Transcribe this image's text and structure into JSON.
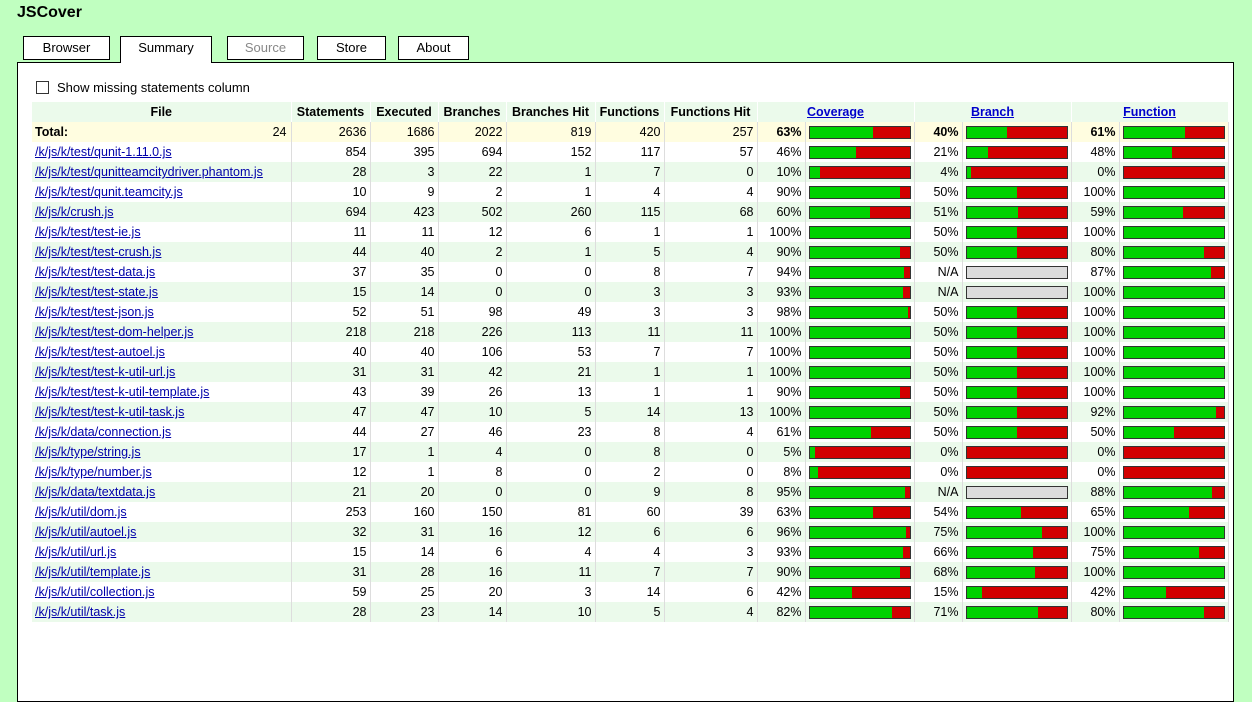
{
  "app": {
    "title": "JSCover"
  },
  "tabs": [
    {
      "label": "Browser",
      "state": "normal"
    },
    {
      "label": "Summary",
      "state": "active"
    },
    {
      "label": "Source",
      "state": "disabled"
    },
    {
      "label": "Store",
      "state": "normal"
    },
    {
      "label": "About",
      "state": "normal"
    }
  ],
  "options": {
    "show_missing_label": "Show missing statements column",
    "show_missing_checked": false
  },
  "colors": {
    "covered": "#00d200",
    "missed": "#d20000",
    "na": "#dcdcdc",
    "background": "#c0ffc0"
  },
  "table": {
    "headers": {
      "file": "File",
      "statements": "Statements",
      "executed": "Executed",
      "branches": "Branches",
      "branches_hit": "Branches Hit",
      "functions": "Functions",
      "functions_hit": "Functions Hit",
      "coverage": "Coverage",
      "branch": "Branch",
      "function": "Function"
    },
    "total": {
      "label": "Total:",
      "files": "24",
      "statements": "2636",
      "executed": "1686",
      "branches": "2022",
      "branches_hit": "819",
      "functions": "420",
      "functions_hit": "257",
      "coverage": "63%",
      "branch": "40%",
      "function": "61%"
    },
    "rows": [
      {
        "file": "/k/js/k/test/qunit-1.11.0.js",
        "statements": "854",
        "executed": "395",
        "branches": "694",
        "branches_hit": "152",
        "functions": "117",
        "functions_hit": "57",
        "coverage": "46%",
        "branch": "21%",
        "function": "48%"
      },
      {
        "file": "/k/js/k/test/qunitteamcitydriver.phantom.js",
        "statements": "28",
        "executed": "3",
        "branches": "22",
        "branches_hit": "1",
        "functions": "7",
        "functions_hit": "0",
        "coverage": "10%",
        "branch": "4%",
        "function": "0%"
      },
      {
        "file": "/k/js/k/test/qunit.teamcity.js",
        "statements": "10",
        "executed": "9",
        "branches": "2",
        "branches_hit": "1",
        "functions": "4",
        "functions_hit": "4",
        "coverage": "90%",
        "branch": "50%",
        "function": "100%"
      },
      {
        "file": "/k/js/k/crush.js",
        "statements": "694",
        "executed": "423",
        "branches": "502",
        "branches_hit": "260",
        "functions": "115",
        "functions_hit": "68",
        "coverage": "60%",
        "branch": "51%",
        "function": "59%"
      },
      {
        "file": "/k/js/k/test/test-ie.js",
        "statements": "11",
        "executed": "11",
        "branches": "12",
        "branches_hit": "6",
        "functions": "1",
        "functions_hit": "1",
        "coverage": "100%",
        "branch": "50%",
        "function": "100%"
      },
      {
        "file": "/k/js/k/test/test-crush.js",
        "statements": "44",
        "executed": "40",
        "branches": "2",
        "branches_hit": "1",
        "functions": "5",
        "functions_hit": "4",
        "coverage": "90%",
        "branch": "50%",
        "function": "80%"
      },
      {
        "file": "/k/js/k/test/test-data.js",
        "statements": "37",
        "executed": "35",
        "branches": "0",
        "branches_hit": "0",
        "functions": "8",
        "functions_hit": "7",
        "coverage": "94%",
        "branch": "N/A",
        "function": "87%"
      },
      {
        "file": "/k/js/k/test/test-state.js",
        "statements": "15",
        "executed": "14",
        "branches": "0",
        "branches_hit": "0",
        "functions": "3",
        "functions_hit": "3",
        "coverage": "93%",
        "branch": "N/A",
        "function": "100%"
      },
      {
        "file": "/k/js/k/test/test-json.js",
        "statements": "52",
        "executed": "51",
        "branches": "98",
        "branches_hit": "49",
        "functions": "3",
        "functions_hit": "3",
        "coverage": "98%",
        "branch": "50%",
        "function": "100%"
      },
      {
        "file": "/k/js/k/test/test-dom-helper.js",
        "statements": "218",
        "executed": "218",
        "branches": "226",
        "branches_hit": "113",
        "functions": "11",
        "functions_hit": "11",
        "coverage": "100%",
        "branch": "50%",
        "function": "100%"
      },
      {
        "file": "/k/js/k/test/test-autoel.js",
        "statements": "40",
        "executed": "40",
        "branches": "106",
        "branches_hit": "53",
        "functions": "7",
        "functions_hit": "7",
        "coverage": "100%",
        "branch": "50%",
        "function": "100%"
      },
      {
        "file": "/k/js/k/test/test-k-util-url.js",
        "statements": "31",
        "executed": "31",
        "branches": "42",
        "branches_hit": "21",
        "functions": "1",
        "functions_hit": "1",
        "coverage": "100%",
        "branch": "50%",
        "function": "100%"
      },
      {
        "file": "/k/js/k/test/test-k-util-template.js",
        "statements": "43",
        "executed": "39",
        "branches": "26",
        "branches_hit": "13",
        "functions": "1",
        "functions_hit": "1",
        "coverage": "90%",
        "branch": "50%",
        "function": "100%"
      },
      {
        "file": "/k/js/k/test/test-k-util-task.js",
        "statements": "47",
        "executed": "47",
        "branches": "10",
        "branches_hit": "5",
        "functions": "14",
        "functions_hit": "13",
        "coverage": "100%",
        "branch": "50%",
        "function": "92%"
      },
      {
        "file": "/k/js/k/data/connection.js",
        "statements": "44",
        "executed": "27",
        "branches": "46",
        "branches_hit": "23",
        "functions": "8",
        "functions_hit": "4",
        "coverage": "61%",
        "branch": "50%",
        "function": "50%"
      },
      {
        "file": "/k/js/k/type/string.js",
        "statements": "17",
        "executed": "1",
        "branches": "4",
        "branches_hit": "0",
        "functions": "8",
        "functions_hit": "0",
        "coverage": "5%",
        "branch": "0%",
        "function": "0%"
      },
      {
        "file": "/k/js/k/type/number.js",
        "statements": "12",
        "executed": "1",
        "branches": "8",
        "branches_hit": "0",
        "functions": "2",
        "functions_hit": "0",
        "coverage": "8%",
        "branch": "0%",
        "function": "0%"
      },
      {
        "file": "/k/js/k/data/textdata.js",
        "statements": "21",
        "executed": "20",
        "branches": "0",
        "branches_hit": "0",
        "functions": "9",
        "functions_hit": "8",
        "coverage": "95%",
        "branch": "N/A",
        "function": "88%"
      },
      {
        "file": "/k/js/k/util/dom.js",
        "statements": "253",
        "executed": "160",
        "branches": "150",
        "branches_hit": "81",
        "functions": "60",
        "functions_hit": "39",
        "coverage": "63%",
        "branch": "54%",
        "function": "65%"
      },
      {
        "file": "/k/js/k/util/autoel.js",
        "statements": "32",
        "executed": "31",
        "branches": "16",
        "branches_hit": "12",
        "functions": "6",
        "functions_hit": "6",
        "coverage": "96%",
        "branch": "75%",
        "function": "100%"
      },
      {
        "file": "/k/js/k/util/url.js",
        "statements": "15",
        "executed": "14",
        "branches": "6",
        "branches_hit": "4",
        "functions": "4",
        "functions_hit": "3",
        "coverage": "93%",
        "branch": "66%",
        "function": "75%"
      },
      {
        "file": "/k/js/k/util/template.js",
        "statements": "31",
        "executed": "28",
        "branches": "16",
        "branches_hit": "11",
        "functions": "7",
        "functions_hit": "7",
        "coverage": "90%",
        "branch": "68%",
        "function": "100%"
      },
      {
        "file": "/k/js/k/util/collection.js",
        "statements": "59",
        "executed": "25",
        "branches": "20",
        "branches_hit": "3",
        "functions": "14",
        "functions_hit": "6",
        "coverage": "42%",
        "branch": "15%",
        "function": "42%"
      },
      {
        "file": "/k/js/k/util/task.js",
        "statements": "28",
        "executed": "23",
        "branches": "14",
        "branches_hit": "10",
        "functions": "5",
        "functions_hit": "4",
        "coverage": "82%",
        "branch": "71%",
        "function": "80%"
      }
    ]
  }
}
